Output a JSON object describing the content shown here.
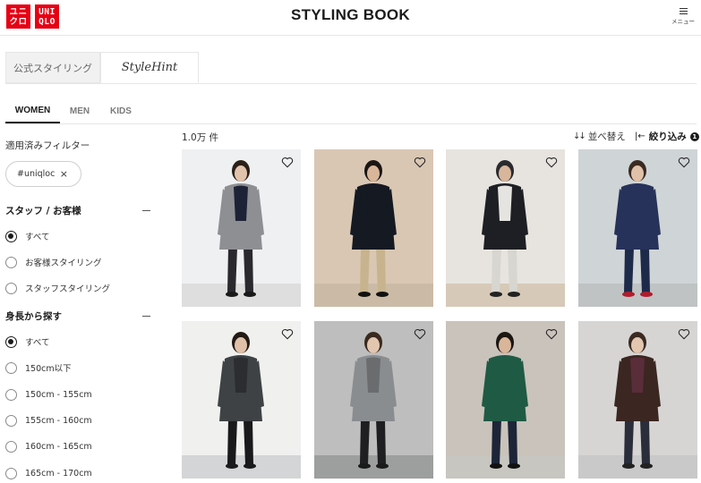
{
  "header": {
    "logo_top": "ユニ",
    "logo_bottom": "クロ",
    "logo_en_top": "UNI",
    "logo_en_bottom": "QLO",
    "title": "STYLING BOOK",
    "menu_label": "メニュー"
  },
  "source_tabs": [
    {
      "label": "公式スタイリング"
    },
    {
      "label": "StyleHint"
    }
  ],
  "gender_tabs": [
    {
      "label": "WOMEN",
      "active": true
    },
    {
      "label": "MEN",
      "active": false
    },
    {
      "label": "KIDS",
      "active": false
    }
  ],
  "sidebar": {
    "applied_title": "適用済みフィルター",
    "chip_label": "#uniqloc",
    "chip_close": "×",
    "staff_section": {
      "title": "スタッフ / お客様",
      "options": [
        "すべて",
        "お客様スタイリング",
        "スタッフスタイリング"
      ],
      "selected_index": 0
    },
    "height_section": {
      "title": "身長から探す",
      "options": [
        "すべて",
        "150cm以下",
        "150cm - 155cm",
        "155cm - 160cm",
        "160cm - 165cm",
        "165cm - 170cm"
      ],
      "selected_index": 0
    }
  },
  "results": {
    "count": "1.0万 件",
    "sort_label": "並べ替え",
    "filter_label": "絞り込み",
    "filter_count": "1"
  },
  "grid": [
    {
      "bg": "#eef0f1",
      "coat": "#8d8f93",
      "top": "#1e2236",
      "bottom": "#2a2a2e",
      "skin": "#e2c4ad",
      "hair": "#2b2018",
      "floor": "#dedede",
      "shoe": "#1a1a1a"
    },
    {
      "bg": "#d9c7b4",
      "coat": "#151922",
      "top": "#151922",
      "bottom": "#c7b48f",
      "skin": "#d9b69a",
      "hair": "#1b1513",
      "floor": "#cbbba6",
      "shoe": "#111"
    },
    {
      "bg": "#e7e4df",
      "coat": "#1d1f24",
      "top": "#e5e4e0",
      "bottom": "#d8d6d0",
      "skin": "#d8b69c",
      "hair": "#2a2a2e",
      "floor": "#d7c9b8",
      "shoe": "#222"
    },
    {
      "bg": "#cfd4d6",
      "coat": "#27325a",
      "top": "#27325a",
      "bottom": "#1e2a4a",
      "skin": "#e0c0a8",
      "hair": "#3a2a20",
      "floor": "#bfc3c4",
      "shoe": "#b01d2e"
    },
    {
      "bg": "#f0f0ef",
      "coat": "#3e4245",
      "top": "#2b2d30",
      "bottom": "#1a1a1c",
      "skin": "#e0c0a8",
      "hair": "#241a14",
      "floor": "#d3d5d6",
      "shoe": "#1a1a1a"
    },
    {
      "bg": "#bdbebd",
      "coat": "#8a8d90",
      "top": "#6a6c6e",
      "bottom": "#1f1f22",
      "skin": "#e2c6b0",
      "hair": "#3b2a1f",
      "floor": "#9d9e9e",
      "shoe": "#1a1a1a"
    },
    {
      "bg": "#c9c3bb",
      "coat": "#1f5a45",
      "top": "#1f5a45",
      "bottom": "#1d2538",
      "skin": "#d9b69a",
      "hair": "#1c1613",
      "floor": "#c8c6c1",
      "shoe": "#111"
    },
    {
      "bg": "#d6d5d4",
      "coat": "#3b2621",
      "top": "#5a2d3a",
      "bottom": "#2a2d3a",
      "skin": "#e2c6b0",
      "hair": "#3a2a22",
      "floor": "#c9c9c9",
      "shoe": "#222"
    }
  ],
  "icons": {
    "heart": "heart-icon",
    "sort": "sort-arrows-icon",
    "filter": "filter-arrow-icon",
    "menu": "hamburger-icon"
  },
  "colors": {
    "brand_red": "#e60012",
    "text": "#1b1b1b",
    "border": "#e6e6e6"
  }
}
